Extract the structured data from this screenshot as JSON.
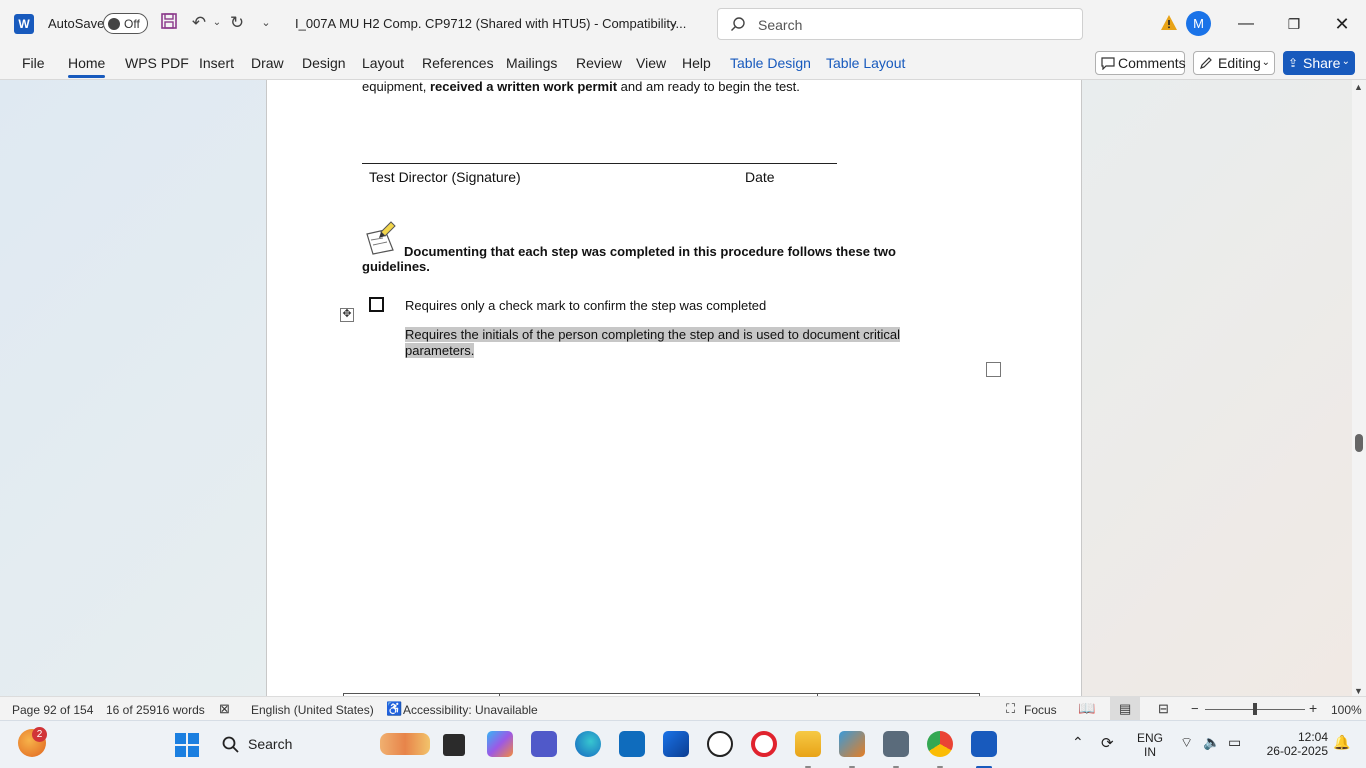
{
  "titlebar": {
    "autosave_label": "AutoSave",
    "autosave_state": "Off",
    "doc_title": "I_007A MU H2 Comp. CP9712 (Shared with HTU5)  -  Compatibility...",
    "search_placeholder": "Search",
    "avatar_initial": "M"
  },
  "ribbon": {
    "tabs": [
      "File",
      "Home",
      "WPS PDF",
      "Insert",
      "Draw",
      "Design",
      "Layout",
      "References",
      "Mailings",
      "Review",
      "View",
      "Help",
      "Table Design",
      "Table Layout"
    ],
    "comments_label": "Comments",
    "editing_label": "Editing",
    "share_label": "Share"
  },
  "document": {
    "line1_a": "equipment, ",
    "line1_b": "received a written work permit",
    "line1_c": " and am ready to begin the test.",
    "signature_label": "Test Director (Signature)",
    "date_label": "Date",
    "note_line1": "Documenting that each step was completed in this procedure follows these two",
    "note_line2": "guidelines.",
    "guideline1": "Requires only a check mark to confirm the step was completed",
    "guideline2_line1": "Requires the initials of the person completing the step and is used to document critical",
    "guideline2_line2": "parameters."
  },
  "statusbar": {
    "page": "Page 92 of 154",
    "words": "16 of 25916 words",
    "language": "English (United States)",
    "accessibility": "Accessibility: Unavailable",
    "focus": "Focus",
    "zoom": "100%"
  },
  "taskbar": {
    "search_label": "Search",
    "notification_count": "2",
    "lang_line1": "ENG",
    "lang_line2": "IN",
    "time": "12:04",
    "date": "26-02-2025"
  }
}
